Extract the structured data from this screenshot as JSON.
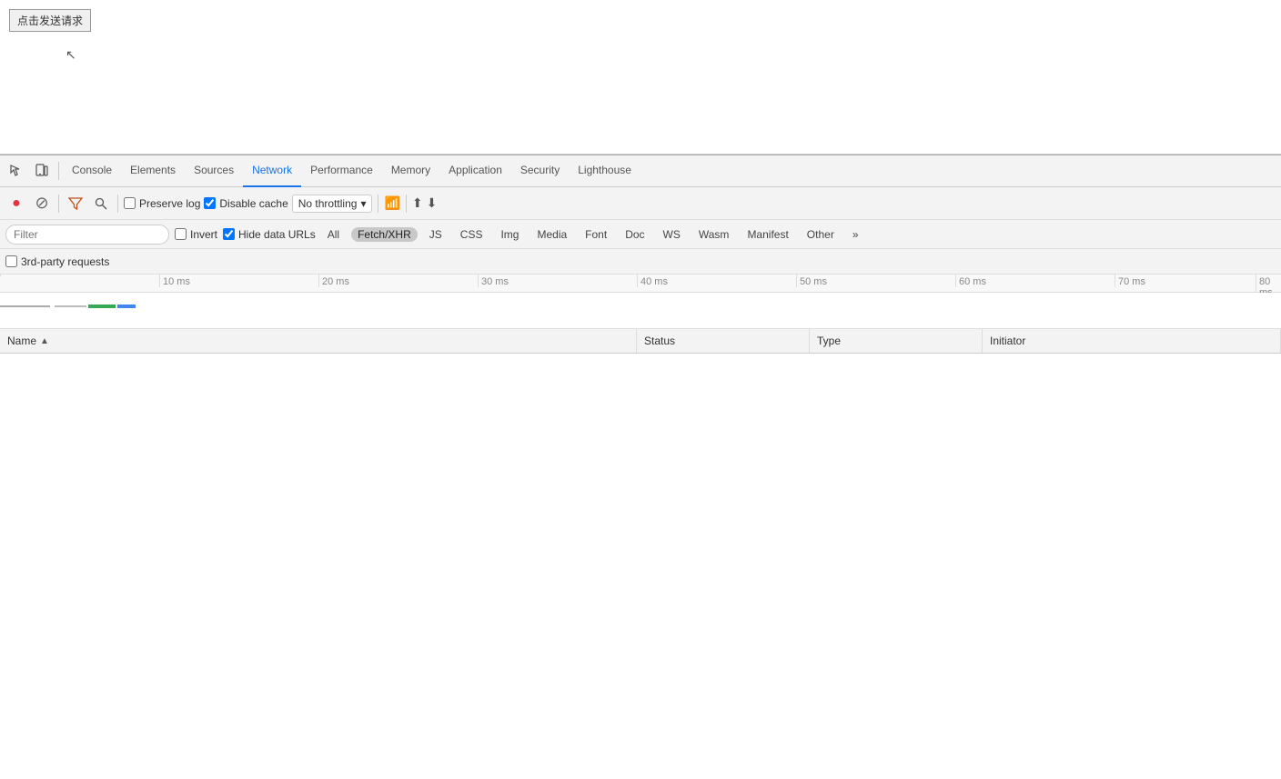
{
  "page": {
    "button_label": "点击发送请求"
  },
  "devtools": {
    "tabs": [
      {
        "id": "console",
        "label": "Console"
      },
      {
        "id": "elements",
        "label": "Elements"
      },
      {
        "id": "sources",
        "label": "Sources"
      },
      {
        "id": "network",
        "label": "Network",
        "active": true
      },
      {
        "id": "performance",
        "label": "Performance"
      },
      {
        "id": "memory",
        "label": "Memory"
      },
      {
        "id": "application",
        "label": "Application"
      },
      {
        "id": "security",
        "label": "Security"
      },
      {
        "id": "lighthouse",
        "label": "Lighthouse"
      }
    ],
    "toolbar": {
      "preserve_log": "Preserve log",
      "disable_cache": "Disable cache",
      "throttle": "No throttling"
    },
    "filter_bar": {
      "placeholder": "Filter",
      "invert_label": "Invert",
      "hide_data_urls_label": "Hide data URLs",
      "chips": [
        "All",
        "Fetch/XHR",
        "JS",
        "CSS",
        "Img",
        "Media",
        "Font",
        "Doc",
        "WS",
        "Wasm",
        "Manifest",
        "Other"
      ],
      "active_chip": "Fetch/XHR"
    },
    "third_party": {
      "label": "3rd-party requests"
    },
    "timeline": {
      "marks": [
        "10 ms",
        "20 ms",
        "30 ms",
        "40 ms",
        "50 ms",
        "60 ms",
        "70 ms",
        "80 ms"
      ]
    },
    "table": {
      "columns": [
        {
          "id": "name",
          "label": "Name"
        },
        {
          "id": "status",
          "label": "Status"
        },
        {
          "id": "type",
          "label": "Type"
        },
        {
          "id": "initiator",
          "label": "Initiator"
        }
      ]
    }
  }
}
